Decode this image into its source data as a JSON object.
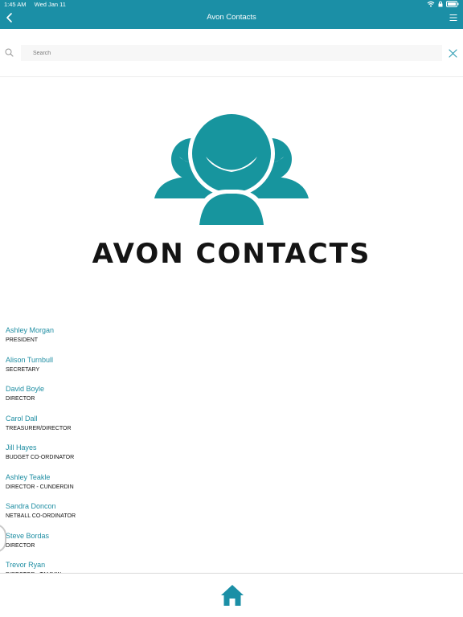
{
  "status_bar": {
    "time": "1:45 AM",
    "date": "Wed Jan 11"
  },
  "header": {
    "title": "Avon Contacts",
    "back_icon": "chevron-left-icon",
    "menu_icon": "hamburger-menu-icon"
  },
  "search": {
    "placeholder": "Search",
    "value": "",
    "search_icon": "search-icon",
    "clear_icon": "close-icon"
  },
  "hero": {
    "title": "AVON CONTACTS",
    "logo_icon": "group-of-people-icon"
  },
  "colors": {
    "accent": "#1b8fa6",
    "logo": "#17959e",
    "link": "#1f8ea3"
  },
  "contacts": [
    {
      "name": "Ashley Morgan",
      "role": "PRESIDENT"
    },
    {
      "name": "Alison Turnbull",
      "role": "SECRETARY"
    },
    {
      "name": "David Boyle",
      "role": "DIRECTOR"
    },
    {
      "name": "Carol Dall",
      "role": "TREASURER/DIRECTOR"
    },
    {
      "name": "Jill Hayes",
      "role": "BUDGET CO-ORDINATOR"
    },
    {
      "name": "Ashley Teakle",
      "role": "DIRECTOR - CUNDERDIN"
    },
    {
      "name": "Sandra Doncon",
      "role": "NETBALL CO-ORDINATOR"
    },
    {
      "name": "Steve Bordas",
      "role": "DIRECTOR"
    },
    {
      "name": "Trevor Ryan",
      "role": "DIRECTOR - TAMMIN"
    }
  ],
  "tab_bar": {
    "home_icon": "home-icon"
  }
}
